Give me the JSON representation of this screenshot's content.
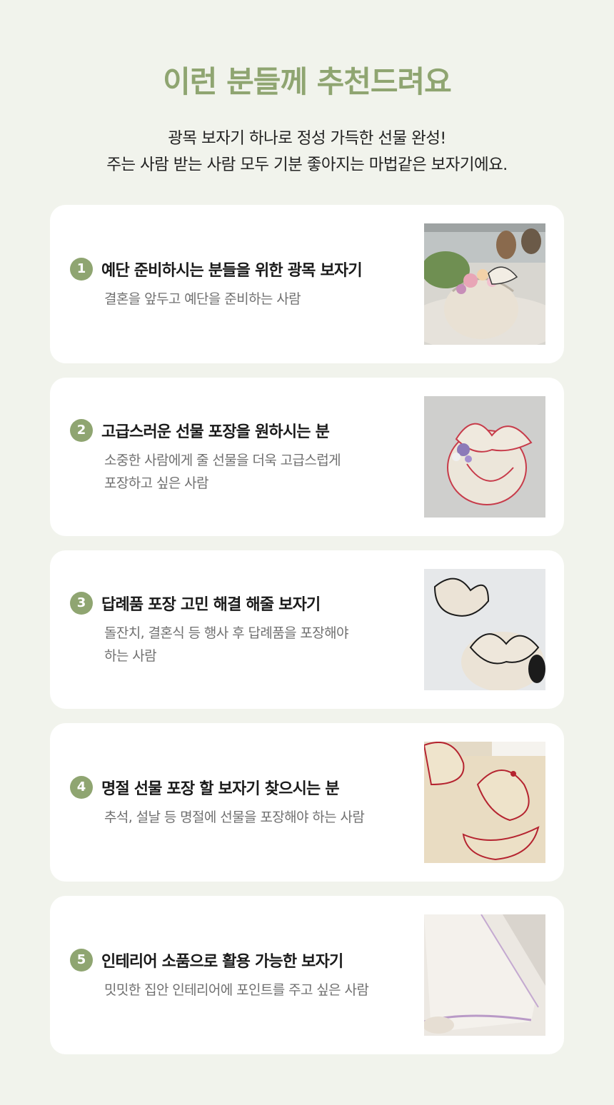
{
  "header": {
    "title": "이런 분들께 추천드려요",
    "subtitle_line1": "광목 보자기 하나로 정성 가득한 선물 완성!",
    "subtitle_line2": "주는 사람 받는 사람 모두 기분 좋아지는 마법같은 보자기에요."
  },
  "cards": [
    {
      "number": "1",
      "title": "예단 준비하시는 분들을 위한 광목 보자기",
      "desc_line1": "결혼을 앞두고 예단을 준비하는 사람",
      "desc_line2": ""
    },
    {
      "number": "2",
      "title": "고급스러운 선물 포장을 원하시는 분",
      "desc_line1": "소중한 사람에게 줄 선물을 더욱 고급스럽게",
      "desc_line2": "포장하고 싶은 사람"
    },
    {
      "number": "3",
      "title": "답례품 포장 고민 해결 해줄 보자기",
      "desc_line1": "돌잔치, 결혼식 등 행사 후 답례품을 포장해야",
      "desc_line2": "하는 사람"
    },
    {
      "number": "4",
      "title": "명절 선물 포장 할 보자기 찾으시는 분",
      "desc_line1": "추석, 설날 등 명절에 선물을 포장해야 하는 사람",
      "desc_line2": ""
    },
    {
      "number": "5",
      "title": "인테리어 소품으로 활용 가능한 보자기",
      "desc_line1": "밋밋한 집안 인테리어에 포인트를 주고 싶은 사람",
      "desc_line2": ""
    }
  ],
  "colors": {
    "background": "#f1f3ec",
    "accent": "#8fa571",
    "card": "#ffffff"
  }
}
